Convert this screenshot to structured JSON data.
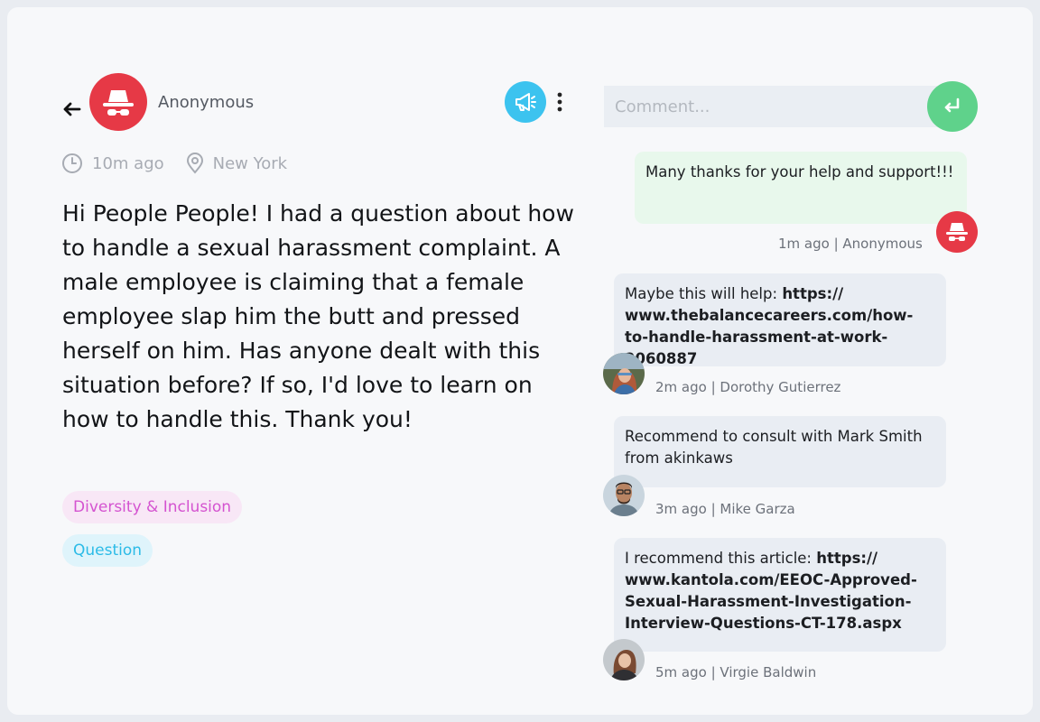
{
  "post": {
    "author": "Anonymous",
    "time": "10m ago",
    "location": "New York",
    "body": "Hi People People! I had a question about how to handle a sexual harassment complaint. A male employee is claiming that a female employee slap him the butt and pressed herself on him. Has anyone dealt with this situation before? If so, I'd love to learn on how to handle this. Thank you!",
    "tags": [
      "Diversity & Inclusion",
      "Question"
    ]
  },
  "comment_input": {
    "placeholder": "Comment..."
  },
  "comments": [
    {
      "text": "Many thanks for your help and support!!!",
      "link": "",
      "meta": "1m ago | Anonymous"
    },
    {
      "text": "Maybe this will help: ",
      "link": "https:// www.thebalancecareers.com/how-to-handle-harassment-at-work-2060887",
      "meta": "2m ago | Dorothy Gutierrez"
    },
    {
      "text": "Recommend to consult with Mark Smith from akinkaws",
      "link": "",
      "meta": "3m ago | Mike Garza"
    },
    {
      "text": "I recommend this article: ",
      "link": "https:// www.kantola.com/EEOC-Approved-Sexual-Harassment-Investigation-Interview-Questions-CT-178.aspx",
      "meta": "5m ago | Virgie Baldwin"
    }
  ],
  "icons": {
    "back": "arrow-left-icon",
    "anonymous": "incognito-icon",
    "announce": "megaphone-icon",
    "more": "kebab-icon",
    "time": "clock-icon",
    "location": "map-pin-icon",
    "send": "enter-icon"
  },
  "colors": {
    "anonymous_red": "#e63946",
    "megaphone_blue": "#3cc3ef",
    "send_green": "#5fd28b",
    "tag_diversity": "#d453d0",
    "tag_question": "#2cbbe7"
  }
}
